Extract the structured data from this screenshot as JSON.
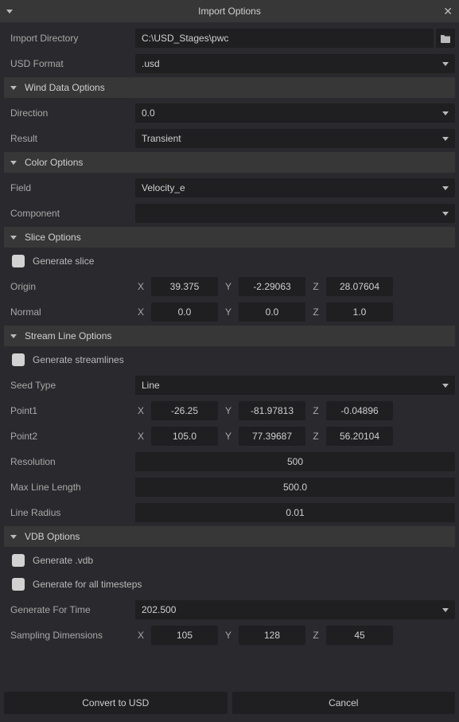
{
  "title": "Import Options",
  "import_dir_label": "Import Directory",
  "import_dir_value": "C:\\USD_Stages\\pwc",
  "usd_format_label": "USD Format",
  "usd_format_value": ".usd",
  "wind": {
    "header": "Wind Data Options",
    "direction_label": "Direction",
    "direction_value": "0.0",
    "result_label": "Result",
    "result_value": "Transient"
  },
  "color": {
    "header": "Color Options",
    "field_label": "Field",
    "field_value": "Velocity_e",
    "component_label": "Component",
    "component_value": ""
  },
  "slice": {
    "header": "Slice Options",
    "gen_label": "Generate slice",
    "origin_label": "Origin",
    "origin": {
      "x": "39.375",
      "y": "-2.29063",
      "z": "28.07604"
    },
    "normal_label": "Normal",
    "normal": {
      "x": "0.0",
      "y": "0.0",
      "z": "1.0"
    }
  },
  "stream": {
    "header": "Stream Line Options",
    "gen_label": "Generate streamlines",
    "seed_type_label": "Seed Type",
    "seed_type_value": "Line",
    "point1_label": "Point1",
    "point1": {
      "x": "-26.25",
      "y": "-81.97813",
      "z": "-0.04896"
    },
    "point2_label": "Point2",
    "point2": {
      "x": "105.0",
      "y": "77.39687",
      "z": "56.20104"
    },
    "resolution_label": "Resolution",
    "resolution_value": "500",
    "max_len_label": "Max Line Length",
    "max_len_value": "500.0",
    "radius_label": "Line Radius",
    "radius_value": "0.01"
  },
  "vdb": {
    "header": "VDB Options",
    "gen_label": "Generate .vdb",
    "gen_all_label": "Generate for all timesteps",
    "time_label": "Generate For Time",
    "time_value": "202.500",
    "sampling_label": "Sampling Dimensions",
    "sampling": {
      "x": "105",
      "y": "128",
      "z": "45"
    }
  },
  "xyz_labels": {
    "x": "X",
    "y": "Y",
    "z": "Z"
  },
  "buttons": {
    "convert": "Convert to USD",
    "cancel": "Cancel"
  }
}
